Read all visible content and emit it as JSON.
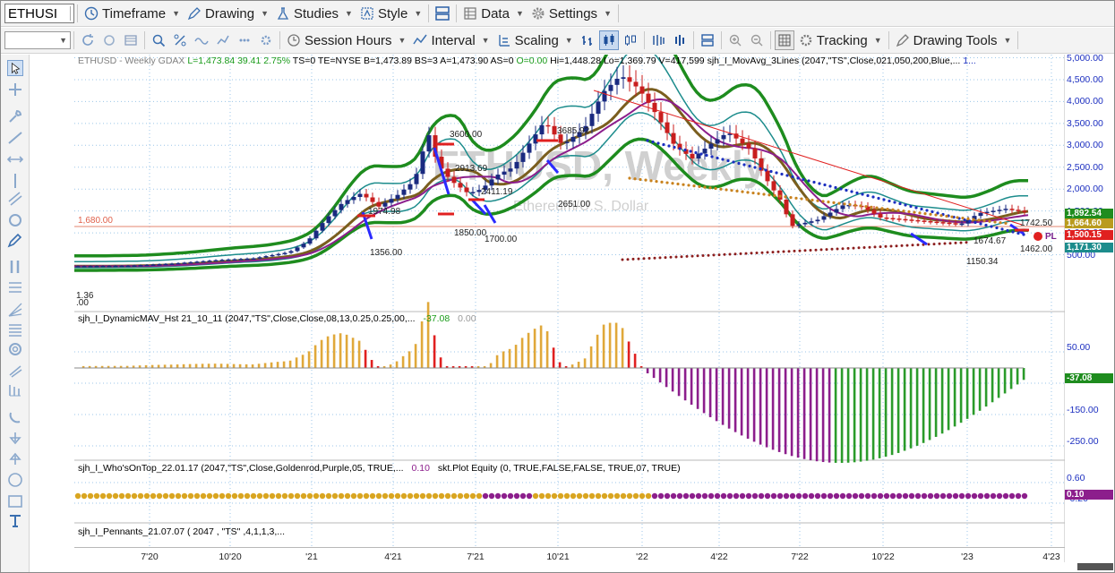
{
  "toolbar": {
    "symbol": "ETHUSI",
    "timeframe": "Timeframe",
    "drawing": "Drawing",
    "studies": "Studies",
    "style": "Style",
    "data": "Data",
    "settings": "Settings",
    "session_hours": "Session Hours",
    "interval": "Interval",
    "scaling": "Scaling",
    "tracking": "Tracking",
    "drawing_tools": "Drawing Tools"
  },
  "chart": {
    "header_parts": [
      {
        "text": "ETHUSD - Weekly  GDAX  ",
        "color": "#7f7f7f"
      },
      {
        "text": "L=1,473.84  39.41  2.75%",
        "color": "#1a9b1a"
      },
      {
        "text": "  TS=0  TE=NYSE  B=1,473.89  BS=3  A=1,473.90  AS=0  ",
        "color": "#000000"
      },
      {
        "text": "O=0.00",
        "color": "#1a9b1a"
      },
      {
        "text": "  Hi=1,448.28  Lo=1,369.79  V=417,599  sjh_I_MovAvg_3Lines (2047,\"TS\",Close,021,050,200,Blue,...",
        "color": "#000000"
      },
      {
        "text": "  1...",
        "color": "#1c2fc0"
      }
    ],
    "watermark": "ETHUSD, Weekly",
    "watermark_sub": "Ethereum/U.S. Dollar",
    "ref_line_label": "1,680.00",
    "price_axis": [
      "5,000.00",
      "4,500.00",
      "4,000.00",
      "3,500.00",
      "3,000.00",
      "2,500.00",
      "2,000.00",
      "1,500.00",
      "1,000.00",
      "500.00"
    ],
    "price_labels": [
      {
        "text": "3600.00"
      },
      {
        "text": "3685.92"
      },
      {
        "text": "2913.69"
      },
      {
        "text": "2411.19"
      },
      {
        "text": "2651.00"
      },
      {
        "text": "1974.98"
      },
      {
        "text": "1850.00"
      },
      {
        "text": "1700.00"
      },
      {
        "text": "1356.00"
      },
      {
        "text": "1150.34"
      },
      {
        "text": "1674.67"
      },
      {
        "text": "1742.50"
      },
      {
        "text": "1462.00"
      },
      {
        "text": "1.36"
      },
      {
        "text": ".00"
      }
    ],
    "price_tags": [
      {
        "text": "1,892.54",
        "color": "#1e8c1e"
      },
      {
        "text": "1,664.60",
        "color": "#b99b1e"
      },
      {
        "text": "1,500.15",
        "color": "#e02020"
      },
      {
        "text": "1,171.30",
        "color": "#1c8c8c"
      }
    ],
    "pl_tag": "PL",
    "panel2": {
      "title": "sjh_I_DynamicMAV_Hst 21_10_11 (2047,\"TS\",Close,Close,08,13,0.25,0.25,00,...",
      "v1": "-37.08",
      "v2": "0.00",
      "axis": [
        "50.00",
        "-50.00",
        "-150.00",
        "-250.00"
      ],
      "tag": "-37.08"
    },
    "panel3": {
      "title": "sjh_I_Who'sOnTop_22.01.17 (2047,\"TS\",Close,Goldenrod,Purple,05, TRUE,...",
      "v1": "0.10",
      "title2": "skt.Plot Equity (0, TRUE,FALSE,FALSE, TRUE,07, TRUE)",
      "axis": [
        "0.60",
        "-0.20"
      ],
      "tag": "0.10"
    },
    "panel4": {
      "title": "sjh_I_Pennants_21.07.07 ( 2047 , \"TS\" ,4,1,1,3,..."
    },
    "time_axis": [
      "7'20",
      "10'20",
      "'21",
      "4'21",
      "7'21",
      "10'21",
      "'22",
      "4'22",
      "7'22",
      "10'22",
      "'23",
      "4'23"
    ]
  },
  "chart_data": {
    "type": "candlestick",
    "title": "ETHUSD - Weekly",
    "ylim": [
      0,
      5200
    ],
    "reference_line": 1680,
    "x": [
      "7'20",
      "10'20",
      "'21",
      "4'21",
      "7'21",
      "10'21",
      "'22",
      "4'22",
      "7'22",
      "10'22",
      "'23",
      "4'23"
    ],
    "close_approx": [
      240,
      380,
      740,
      2100,
      2300,
      3500,
      3700,
      2900,
      1200,
      1300,
      1500,
      1474
    ],
    "last": 1473.84
  }
}
